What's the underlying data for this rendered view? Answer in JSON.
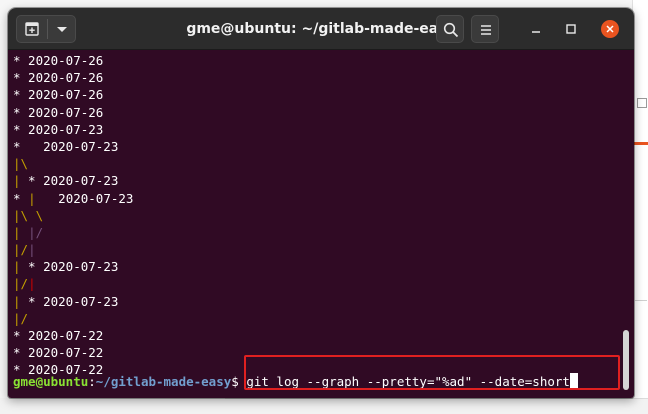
{
  "window": {
    "title": "gme@ubuntu: ~/gitlab-made-easy"
  },
  "titlebar": {
    "icons": {
      "new_tab": "new-tab-icon",
      "menu_arrow": "chevron-down-icon",
      "search": "search-icon",
      "hamburger": "hamburger-menu-icon",
      "minimize": "minimize-icon",
      "maximize": "maximize-icon",
      "close": "close-icon"
    }
  },
  "terminal": {
    "output_lines": [
      [
        {
          "t": "* 2020-07-26"
        }
      ],
      [
        {
          "t": "* 2020-07-26"
        }
      ],
      [
        {
          "t": "* 2020-07-26"
        }
      ],
      [
        {
          "t": "* 2020-07-26"
        }
      ],
      [
        {
          "t": "* 2020-07-23"
        }
      ],
      [
        {
          "t": "*   2020-07-23"
        }
      ],
      [
        {
          "t": "|",
          "c": "yellow"
        },
        {
          "t": "\\",
          "c": "yellow"
        }
      ],
      [
        {
          "t": "|",
          "c": "yellow"
        },
        {
          "t": " * 2020-07-23"
        }
      ],
      [
        {
          "t": "* "
        },
        {
          "t": "|",
          "c": "yellow"
        },
        {
          "t": "   2020-07-23"
        }
      ],
      [
        {
          "t": "|",
          "c": "yellow"
        },
        {
          "t": "\\",
          "c": "yellow"
        },
        {
          "t": " "
        },
        {
          "t": "\\",
          "c": "yellow"
        }
      ],
      [
        {
          "t": "|",
          "c": "yellow"
        },
        {
          "t": " "
        },
        {
          "t": "|",
          "c": "purple"
        },
        {
          "t": "/",
          "c": "purple"
        }
      ],
      [
        {
          "t": "|",
          "c": "yellow"
        },
        {
          "t": "/",
          "c": "yellow"
        },
        {
          "t": "|",
          "c": "purple"
        }
      ],
      [
        {
          "t": "|",
          "c": "yellow"
        },
        {
          "t": " * 2020-07-23"
        }
      ],
      [
        {
          "t": "|",
          "c": "yellow"
        },
        {
          "t": "/",
          "c": "yellow"
        },
        {
          "t": "|",
          "c": "red"
        }
      ],
      [
        {
          "t": "|",
          "c": "yellow"
        },
        {
          "t": " * 2020-07-23"
        }
      ],
      [
        {
          "t": "|",
          "c": "yellow"
        },
        {
          "t": "/",
          "c": "yellow"
        }
      ],
      [
        {
          "t": "* 2020-07-22"
        }
      ],
      [
        {
          "t": "* 2020-07-22"
        }
      ],
      [
        {
          "t": "* 2020-07-22"
        }
      ]
    ],
    "prompt": {
      "user_host": "gme@ubuntu",
      "colon": ":",
      "path": "~/gitlab-made-easy",
      "symbol": "$",
      "command": " git log --graph --pretty=\"%ad\" --date=short"
    },
    "colors": {
      "background": "#300a24",
      "text": "#ffffff",
      "prompt_user": "#8ae234",
      "prompt_path": "#729fcf",
      "graph_yellow": "#c4a000",
      "graph_purple": "#75507b",
      "graph_red": "#cc0000"
    }
  },
  "annotation": {
    "highlight_color": "#e02020"
  }
}
